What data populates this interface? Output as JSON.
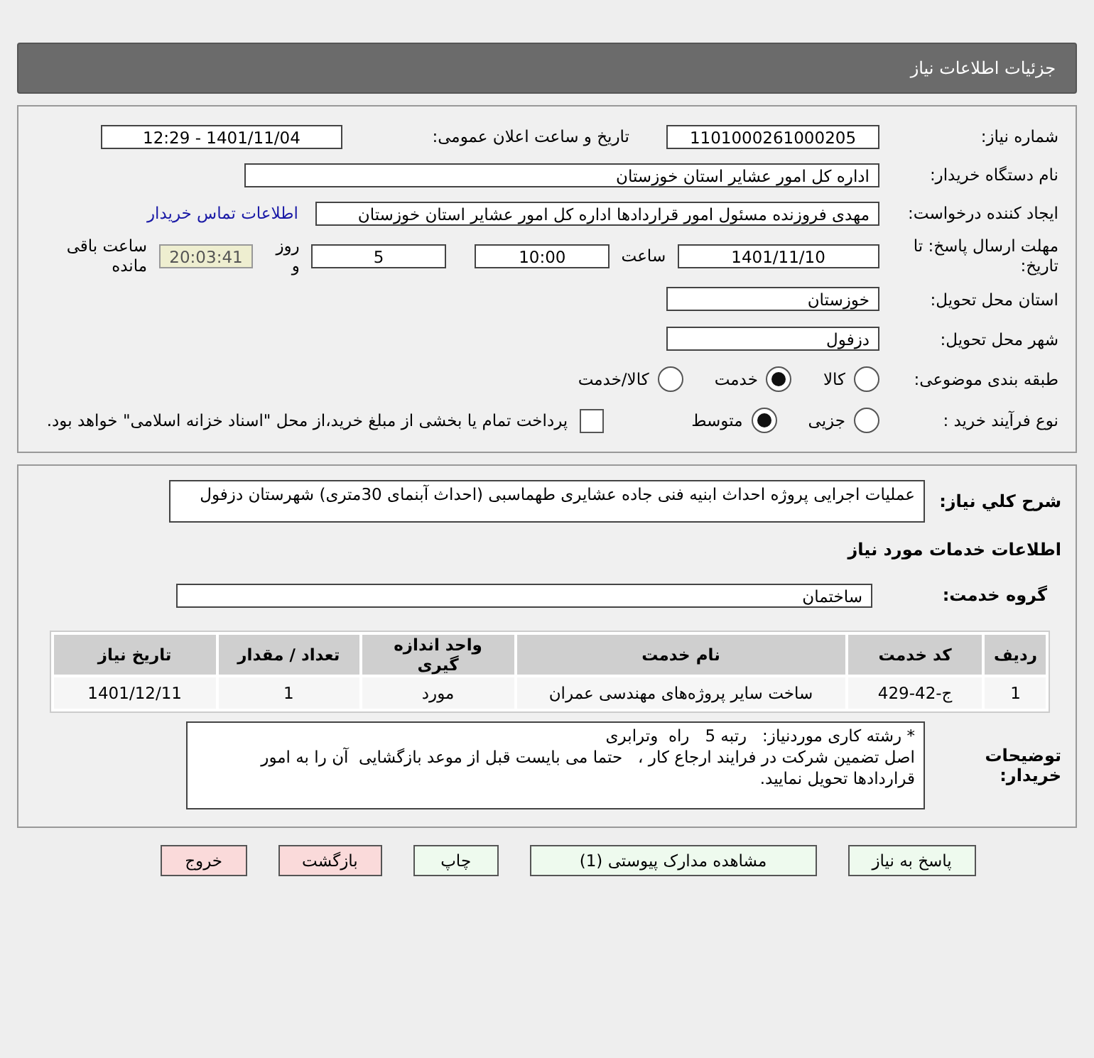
{
  "page_title": "جزئیات اطلاعات نیاز",
  "info": {
    "need_number": {
      "label": "شماره نیاز:",
      "value": "1101000261000205"
    },
    "announce": {
      "label": "تاریخ و ساعت اعلان عمومی:",
      "value": "1401/11/04 - 12:29"
    },
    "buyer": {
      "label": "نام دستگاه خریدار:",
      "value": "اداره کل امور عشایر استان خوزستان"
    },
    "requester": {
      "label": "ایجاد کننده درخواست:",
      "value": "مهدی فروزنده مسئول امور قراردادها اداره کل امور عشایر استان خوزستان",
      "link": "اطلاعات تماس خریدار"
    },
    "deadline": {
      "label": "مهلت ارسال پاسخ: تا تاریخ:",
      "date": "1401/11/10",
      "time_label": "ساعت",
      "time": "10:00",
      "days": "5",
      "days_label": "روز و",
      "remaining": "20:03:41",
      "remaining_label": "ساعت باقی مانده"
    },
    "province": {
      "label": "استان محل تحویل:",
      "value": "خوزستان"
    },
    "city": {
      "label": "شهر محل تحویل:",
      "value": "دزفول"
    },
    "category": {
      "label": "طبقه بندی موضوعی:",
      "options": [
        {
          "label": "کالا",
          "selected": false
        },
        {
          "label": "خدمت",
          "selected": true
        },
        {
          "label": "کالا/خدمت",
          "selected": false
        }
      ]
    },
    "process": {
      "label": "نوع فرآیند خرید :",
      "options": [
        {
          "label": "جزیی",
          "selected": false
        },
        {
          "label": "متوسط",
          "selected": true
        }
      ],
      "payment": {
        "label": "پرداخت تمام یا بخشی از مبلغ خرید،از محل \"اسناد خزانه اسلامی\" خواهد بود.",
        "checked": false
      }
    }
  },
  "details": {
    "summary": {
      "label": "شرح كلي نياز:",
      "value": "عملیات اجرایی پروژه احداث ابنیه فنی  جاده عشایری طهماسبی  (احداث آبنمای 30متری) شهرستان دزفول"
    },
    "services_title": "اطلاعات خدمات مورد نیاز",
    "service_group": {
      "label": "گروه خدمت:",
      "value": "ساختمان"
    },
    "table": {
      "columns": [
        "ردیف",
        "کد خدمت",
        "نام خدمت",
        "واحد اندازه گیری",
        "تعداد / مقدار",
        "تاریخ نیاز"
      ],
      "rows": [
        [
          "1",
          "ج-42-429",
          "ساخت سایر پروژه‌های مهندسی عمران",
          "مورد",
          "1",
          "1401/12/11"
        ]
      ]
    },
    "notes": {
      "label": "توضیحات خریدار:",
      "value": "* رشته کاری موردنیاز:   رتبه 5   راه  وترابری\nاصل تضمین شرکت در فرایند ارجاع کار ،   حتما می بایست قبل از موعد بازگشایی  آن را به امور قراردادها تحویل نمایید."
    }
  },
  "buttons": [
    {
      "label": "پاسخ به نیاز",
      "kind": "normal"
    },
    {
      "label": "مشاهده مدارک پیوستی (1)",
      "kind": "normal"
    },
    {
      "label": "چاپ",
      "kind": "normal"
    },
    {
      "label": "بازگشت",
      "kind": "exit"
    },
    {
      "label": "خروج",
      "kind": "exit"
    }
  ]
}
